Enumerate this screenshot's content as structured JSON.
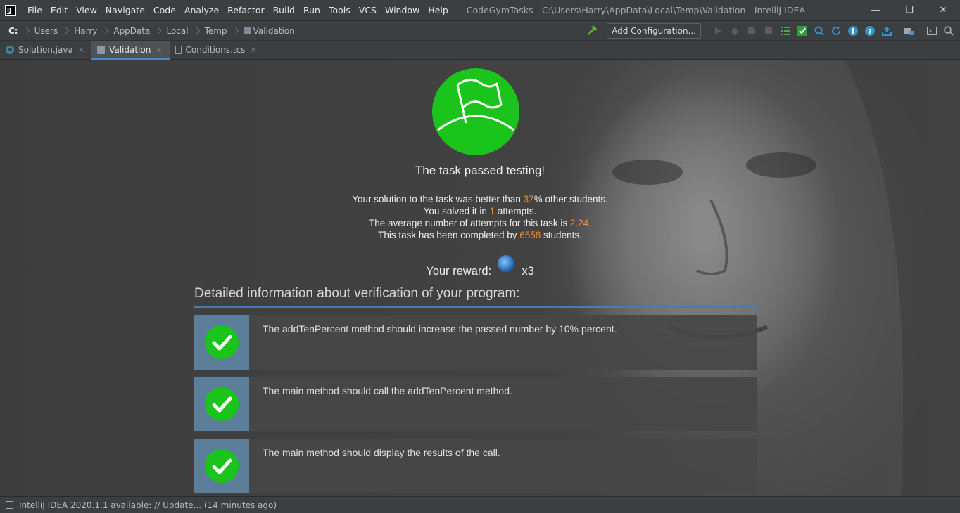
{
  "titlebar": {
    "menu": [
      "File",
      "Edit",
      "View",
      "Navigate",
      "Code",
      "Analyze",
      "Refactor",
      "Build",
      "Run",
      "Tools",
      "VCS",
      "Window",
      "Help"
    ],
    "window_title": "CodeGymTasks - C:\\Users\\Harry\\AppData\\Local\\Temp\\Validation - IntelliJ IDEA"
  },
  "navbar": {
    "crumbs": [
      "C:",
      "Users",
      "Harry",
      "AppData",
      "Local",
      "Temp",
      "Validation"
    ],
    "add_configuration": "Add Configuration..."
  },
  "tabs": [
    {
      "label": "Solution.java",
      "active": false
    },
    {
      "label": "Validation",
      "active": true
    },
    {
      "label": "Conditions.tcs",
      "active": false
    }
  ],
  "result": {
    "title": "The task passed testing!",
    "better_prefix": "Your solution to the task was better than ",
    "better_value": "37",
    "better_suffix": "% other students.",
    "solved_prefix": "You solved it in ",
    "solved_value": "1",
    "solved_suffix": " attempts.",
    "avg_prefix": "The average number of attempts for this task is ",
    "avg_value": "2.24",
    "avg_suffix": ".",
    "completed_prefix": "This task has been completed by ",
    "completed_value": "6558",
    "completed_suffix": " students.",
    "reward_label": "Your reward:",
    "reward_multiplier": "x3"
  },
  "details": {
    "title": "Detailed information about verification of your program:",
    "checks": [
      "The addTenPercent method should increase the passed number by 10% percent.",
      "The main method should call the addTenPercent method.",
      "The main method should display the results of the call."
    ]
  },
  "statusbar": {
    "text": "IntelliJ IDEA 2020.1.1 available: // Update... (14 minutes ago)"
  },
  "colors": {
    "accent": "#4a88c7",
    "success": "#1bc41b",
    "highlight_number": "#f28e2b"
  }
}
